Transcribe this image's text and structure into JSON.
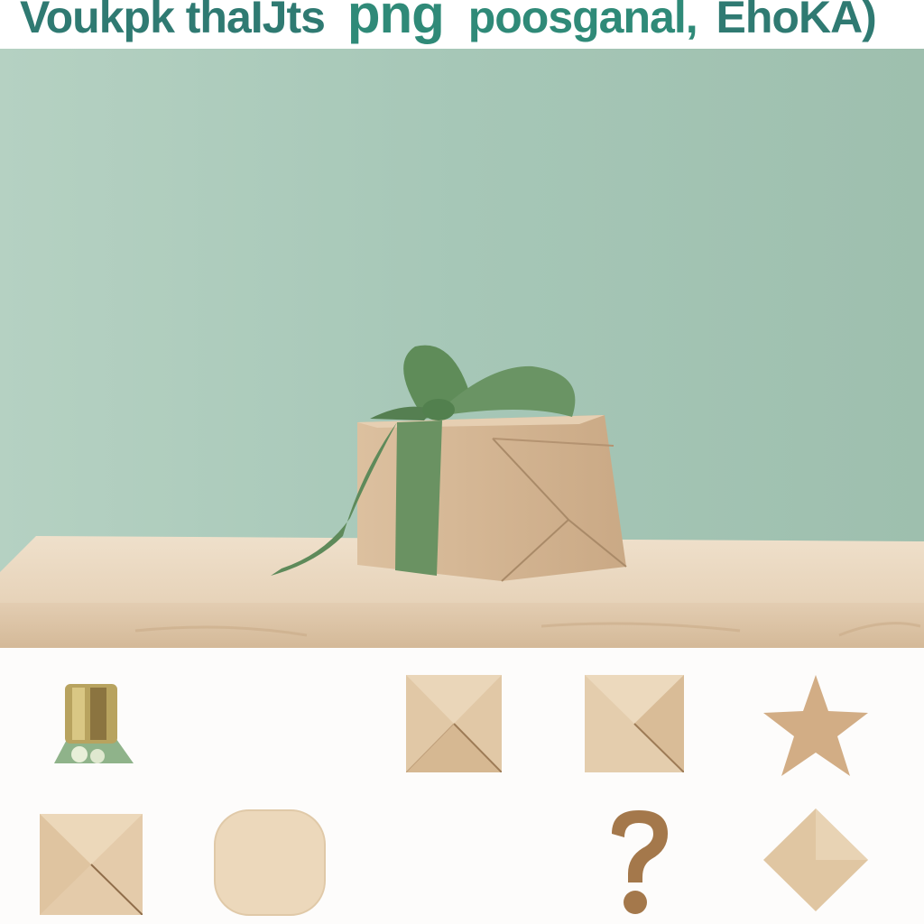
{
  "header": {
    "title_segments": [
      {
        "text": "Voukpk thaIJts",
        "color": "#2f7a72"
      },
      {
        "text": "png",
        "color": "#2f8a78"
      },
      {
        "text": "poosganal,",
        "color": "#2f8a78"
      },
      {
        "text": "EhoKA)",
        "color": "#2f7a72"
      }
    ]
  },
  "scene": {
    "wall_color": "#a9c9b9",
    "table_color": "#ecdcc6",
    "box_color": "#d2b593",
    "ribbon_color": "#5e8a5a"
  },
  "tiles": [
    {
      "icon": "bell-icon"
    },
    {
      "icon": "wooden-square-icon"
    },
    {
      "icon": "wooden-square-icon"
    },
    {
      "icon": "star-icon"
    },
    {
      "icon": "wooden-square-icon"
    },
    {
      "icon": "rounded-square-icon"
    },
    {
      "icon": "question-mark-icon"
    },
    {
      "icon": "diamond-icon"
    }
  ]
}
